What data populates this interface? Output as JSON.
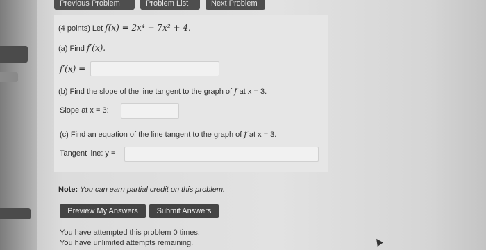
{
  "nav": {
    "previous": "Previous Problem",
    "list": "Problem List",
    "next": "Next Problem"
  },
  "problem": {
    "header_prefix": "(4 points) Let ",
    "header_math": "f(x) = 2x⁴ − 7x² + 4.",
    "part_a_prefix": "(a) Find ",
    "part_a_math": "f′(x).",
    "part_a_label": "f′(x) =",
    "part_b": "(b) Find the slope of the line tangent to the graph of ",
    "part_b_math": "f",
    "part_b_suffix": " at x = 3.",
    "slope_label": "Slope at x = 3:",
    "part_c": "(c) Find an equation of the line tangent to the graph of ",
    "part_c_math": "f",
    "part_c_suffix": " at x = 3.",
    "tangent_label": "Tangent line: y ="
  },
  "note": {
    "bold": "Note:",
    "text": " You can earn partial credit on this problem."
  },
  "buttons": {
    "preview": "Preview My Answers",
    "submit": "Submit Answers"
  },
  "status": {
    "attempted": "You have attempted this problem 0 times.",
    "remaining": "You have unlimited attempts remaining."
  }
}
